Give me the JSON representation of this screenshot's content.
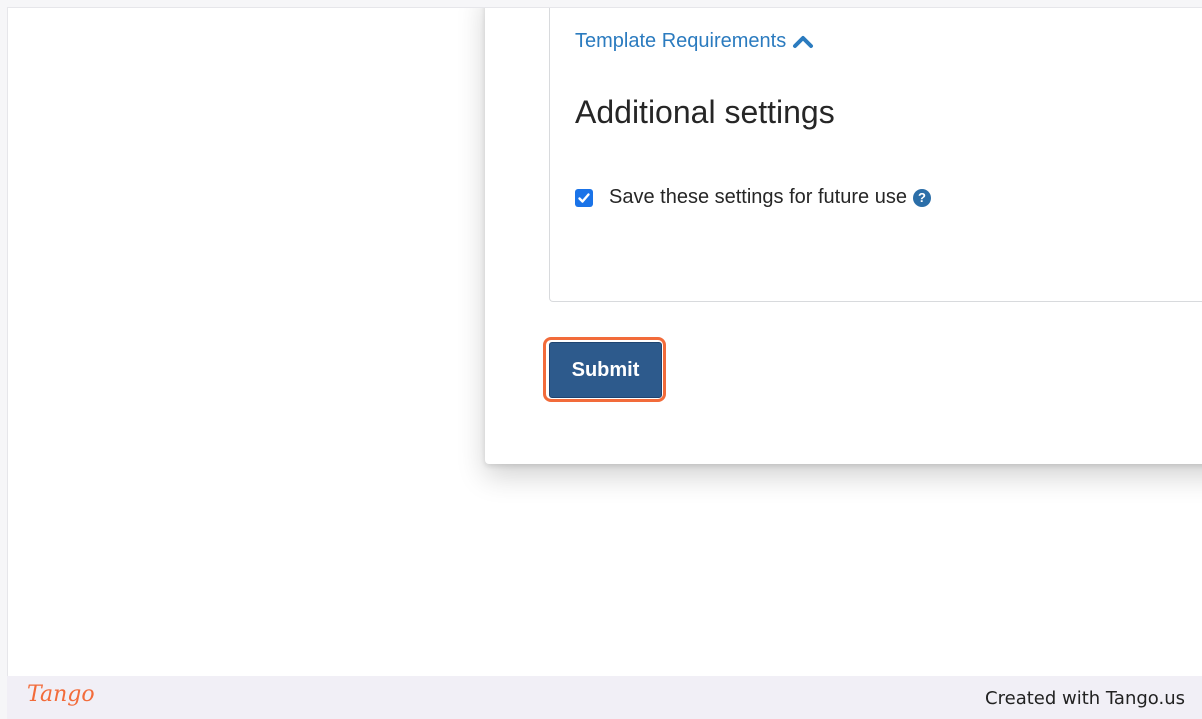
{
  "modal": {
    "template_requirements_link": "Template Requirements",
    "additional_settings_title": "Additional settings",
    "save_settings_label": "Save these settings for future use",
    "save_settings_checked": true,
    "submit_label": "Submit",
    "help_glyph": "?"
  },
  "footer": {
    "logo_text": "Tango",
    "created_text": "Created with Tango.us"
  },
  "colors": {
    "link": "#2b7bbf",
    "submit_button": "#2d5a8c",
    "highlight": "#f26b3a",
    "checkbox": "#1a73e8"
  },
  "icons": {
    "chevron": "chevron-up-icon",
    "help": "question-circle-icon",
    "checkbox": "checkmark-icon"
  }
}
